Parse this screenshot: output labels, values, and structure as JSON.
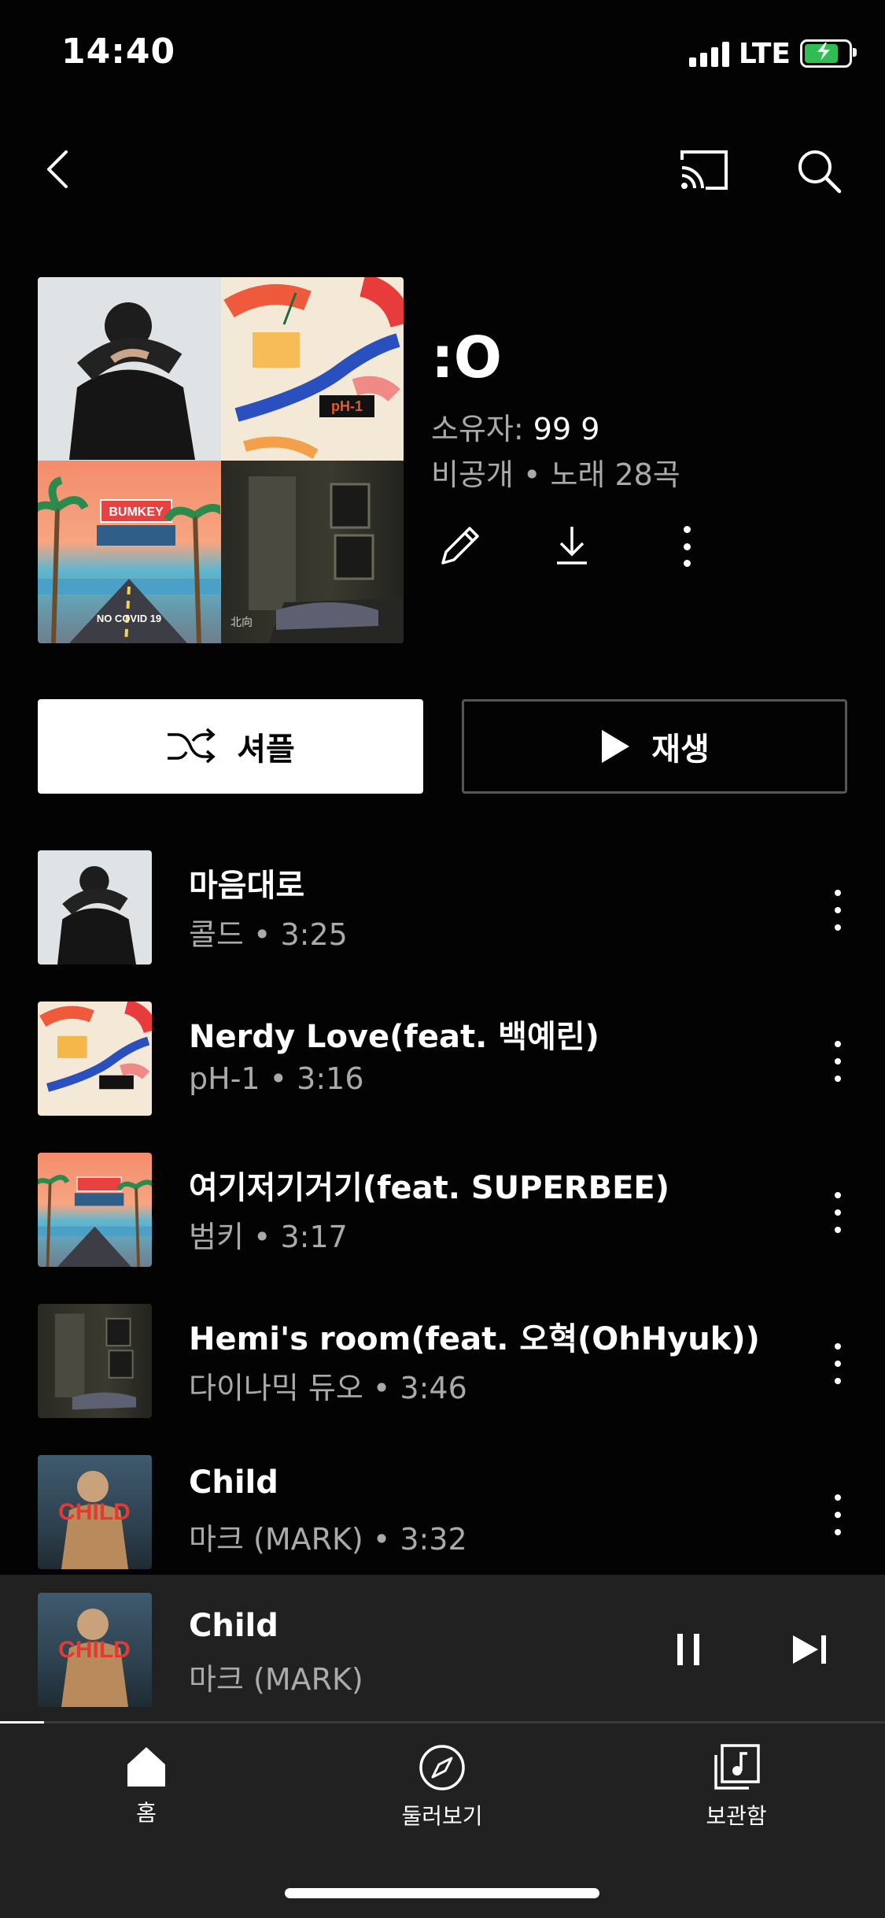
{
  "status": {
    "time": "14:40",
    "network": "LTE"
  },
  "header": {
    "back_icon": "chevron-left-icon",
    "cast_icon": "cast-icon",
    "search_icon": "search-icon"
  },
  "playlist": {
    "title": ":O",
    "owner_label": "소유자:",
    "owner_name": "99 9",
    "meta": "비공개 • 노래 28곡",
    "cover_texts": {
      "ph1": "pH-1",
      "bumkey": "BUMKEY",
      "no_covid": "NO COVID 19",
      "room": "北向"
    }
  },
  "actions": {
    "shuffle_label": "셔플",
    "play_label": "재생"
  },
  "tracks": [
    {
      "title": "마음대로",
      "artist": "콜드",
      "duration": "3:25",
      "subtitle": "콜드 • 3:25",
      "art": "man"
    },
    {
      "title": "Nerdy Love(feat. 백예린)",
      "artist": "pH-1",
      "duration": "3:16",
      "subtitle": "pH-1 • 3:16",
      "art": "ph1"
    },
    {
      "title": "여기저기거기(feat. SUPERBEE)",
      "artist": "범키",
      "duration": "3:17",
      "subtitle": "범키 • 3:17",
      "art": "bum"
    },
    {
      "title": "Hemi's room(feat. 오혁(OhHyuk))",
      "artist": "다이나믹 듀오",
      "duration": "3:46",
      "subtitle": "다이나믹 듀오 • 3:46",
      "art": "room"
    },
    {
      "title": "Child",
      "artist": "마크 (MARK)",
      "duration": "3:32",
      "subtitle": "마크 (MARK) • 3:32",
      "art": "child"
    }
  ],
  "now_playing": {
    "title": "Child",
    "artist": "마크 (MARK)",
    "progress": 0.05,
    "art_text": "CHILD"
  },
  "nav": {
    "items": [
      {
        "label": "홈",
        "icon": "home-icon",
        "active": true
      },
      {
        "label": "둘러보기",
        "icon": "compass-icon",
        "active": false
      },
      {
        "label": "보관함",
        "icon": "library-icon",
        "active": false
      }
    ]
  },
  "colors": {
    "background": "#030303",
    "panel": "#212121",
    "secondary_text": "#aaaaaa"
  }
}
